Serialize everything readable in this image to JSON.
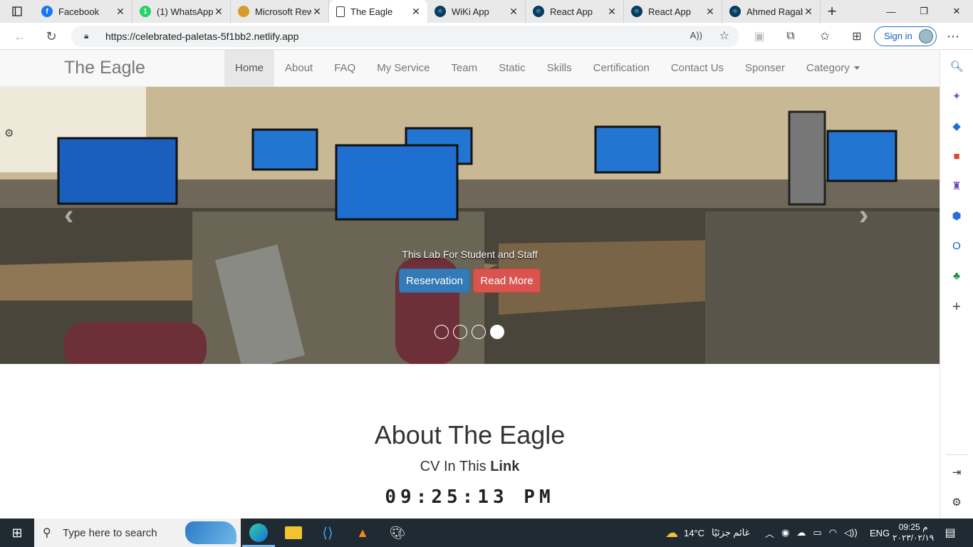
{
  "browser": {
    "tabs": [
      {
        "title": "Facebook",
        "favicon": "facebook-icon",
        "color": "#1877f2"
      },
      {
        "title": "(1) WhatsApp",
        "favicon": "whatsapp-icon",
        "color": "#25d366"
      },
      {
        "title": "Microsoft Rew",
        "favicon": "rewards-icon",
        "color": "#d89b2b"
      },
      {
        "title": "The Eagle",
        "favicon": "page-icon",
        "color": "#ffffff"
      },
      {
        "title": "WiKi App",
        "favicon": "react-icon",
        "color": "#0b3a5b"
      },
      {
        "title": "React App",
        "favicon": "react-icon",
        "color": "#0b3a5b"
      },
      {
        "title": "React App",
        "favicon": "react-icon",
        "color": "#0b3a5b"
      },
      {
        "title": "Ahmed Ragab",
        "favicon": "react-icon",
        "color": "#0b3a5b"
      }
    ],
    "active_tab": 3,
    "url": "https://celebrated-paletas-5f1bb2.netlify.app",
    "sign_in_label": "Sign in"
  },
  "site": {
    "brand": "The Eagle",
    "menu": [
      "Home",
      "About",
      "FAQ",
      "My Service",
      "Team",
      "Static",
      "Skills",
      "Certification",
      "Contact Us",
      "Sponser",
      "Category"
    ],
    "active_menu": "Home",
    "carousel": {
      "caption": "This Lab For Student and Staff",
      "reservation_label": "Reservation",
      "read_more_label": "Read More",
      "slide_count": 4,
      "active_slide": 4
    },
    "about": {
      "title": "About The Eagle",
      "cv_text": "CV In This ",
      "cv_link": "Link",
      "clock": "09:25:13 PM"
    }
  },
  "taskbar": {
    "search_placeholder": "Type here to search",
    "weather_temp": "14°C",
    "weather_text": "غائم جزئيًا",
    "language": "ENG",
    "time": "09:25 م",
    "date": "٢٠٢٣/٠٢/١٩"
  }
}
